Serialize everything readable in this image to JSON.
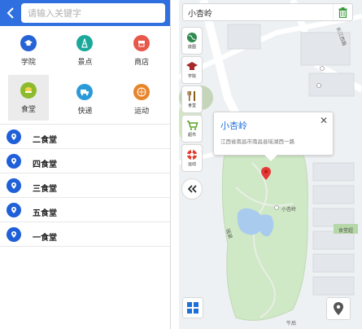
{
  "left": {
    "search_placeholder": "请输入关键字",
    "categories": [
      {
        "label": "学院",
        "icon": "graduation-cap-icon",
        "color": "#2563d6"
      },
      {
        "label": "景点",
        "icon": "landmark-icon",
        "color": "#1aa89b"
      },
      {
        "label": "商店",
        "icon": "store-icon",
        "color": "#e8584a"
      },
      {
        "label": "食堂",
        "icon": "food-icon",
        "color": "#8dbb2d",
        "selected": true
      },
      {
        "label": "快递",
        "icon": "delivery-truck-icon",
        "color": "#2a9ad8"
      },
      {
        "label": "运动",
        "icon": "basketball-icon",
        "color": "#e8842a"
      }
    ],
    "results": [
      {
        "label": "二食堂"
      },
      {
        "label": "四食堂"
      },
      {
        "label": "三食堂"
      },
      {
        "label": "五食堂"
      },
      {
        "label": "一食堂"
      }
    ]
  },
  "map": {
    "search_value": "小杏岭",
    "toolbar": [
      {
        "label": "底图",
        "icon": "globe-icon"
      },
      {
        "label": "学院",
        "icon": "graduation-cap-icon"
      },
      {
        "label": "食堂",
        "icon": "fork-knife-icon"
      },
      {
        "label": "超市",
        "icon": "shopping-cart-icon"
      },
      {
        "label": "运动",
        "icon": "lifebuoy-icon"
      }
    ],
    "popup": {
      "title": "小杏岭",
      "address": "江西省南昌市南昌县瑶湖西一路"
    },
    "labels": {
      "road_top": "长江西路",
      "poi_small": "小杏岭",
      "lake": "瑶湖",
      "shop": "食堂超",
      "bottom": "牛后"
    }
  }
}
